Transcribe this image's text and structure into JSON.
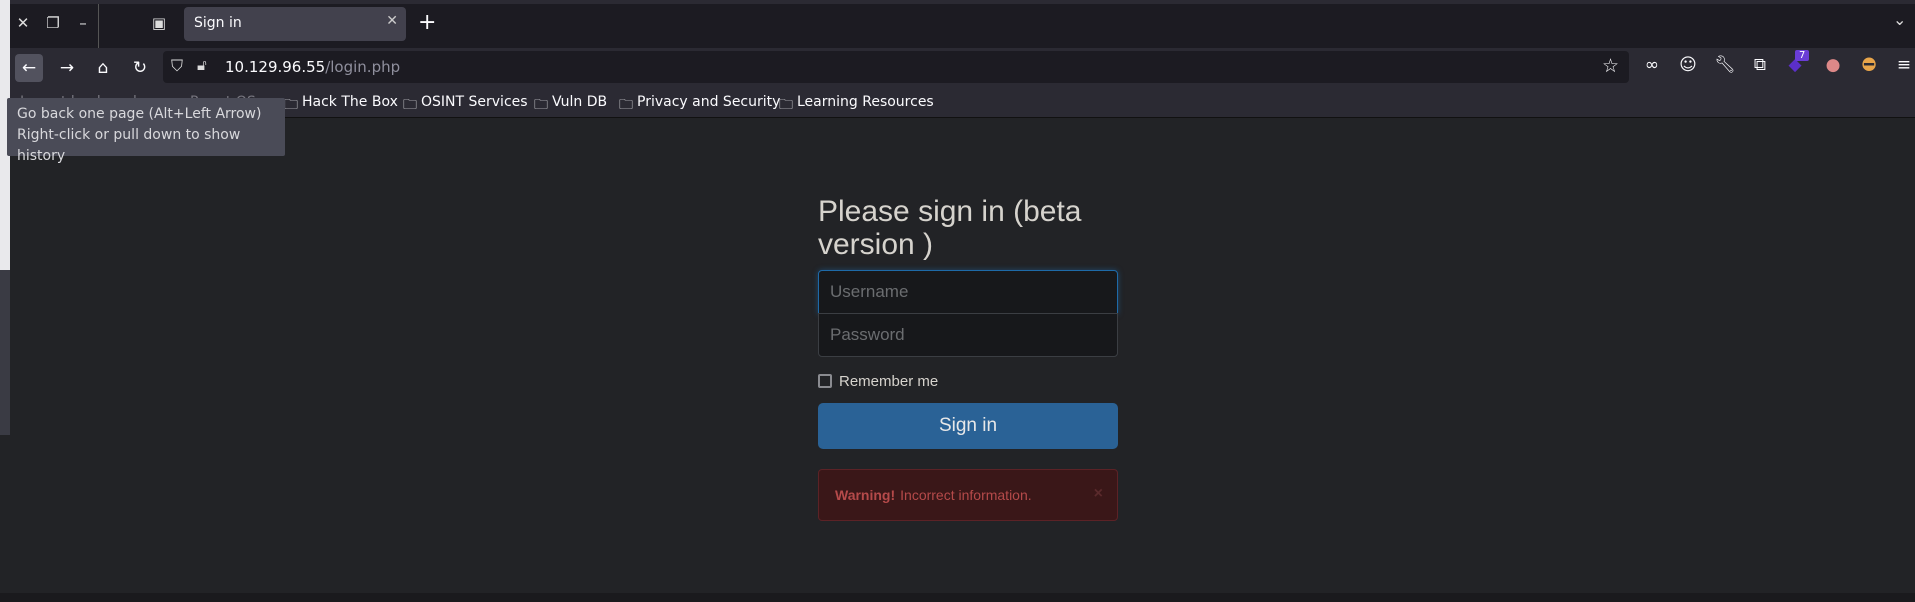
{
  "tab": {
    "title": "Sign in"
  },
  "url": {
    "host": "10.129.96.55",
    "path": "/login.php"
  },
  "bookmarks": [
    "Import bookmarks...",
    "Parrot OS",
    "Hack The Box",
    "OSINT Services",
    "Vuln DB",
    "Privacy and Security",
    "Learning Resources"
  ],
  "tooltip": {
    "line1": "Go back one page (Alt+Left Arrow)",
    "line2": "Right-click or pull down to show history"
  },
  "extension_badge": "7",
  "form": {
    "title": "Please sign in (beta version )",
    "username_placeholder": "Username",
    "password_placeholder": "Password",
    "remember": "Remember me",
    "remember_checked": false,
    "submit": "Sign in"
  },
  "alert": {
    "strong": "Warning!",
    "text": "Incorrect information.",
    "close": "×"
  },
  "colors": {
    "primary": "#2a6296",
    "danger": "#b54a4a"
  }
}
